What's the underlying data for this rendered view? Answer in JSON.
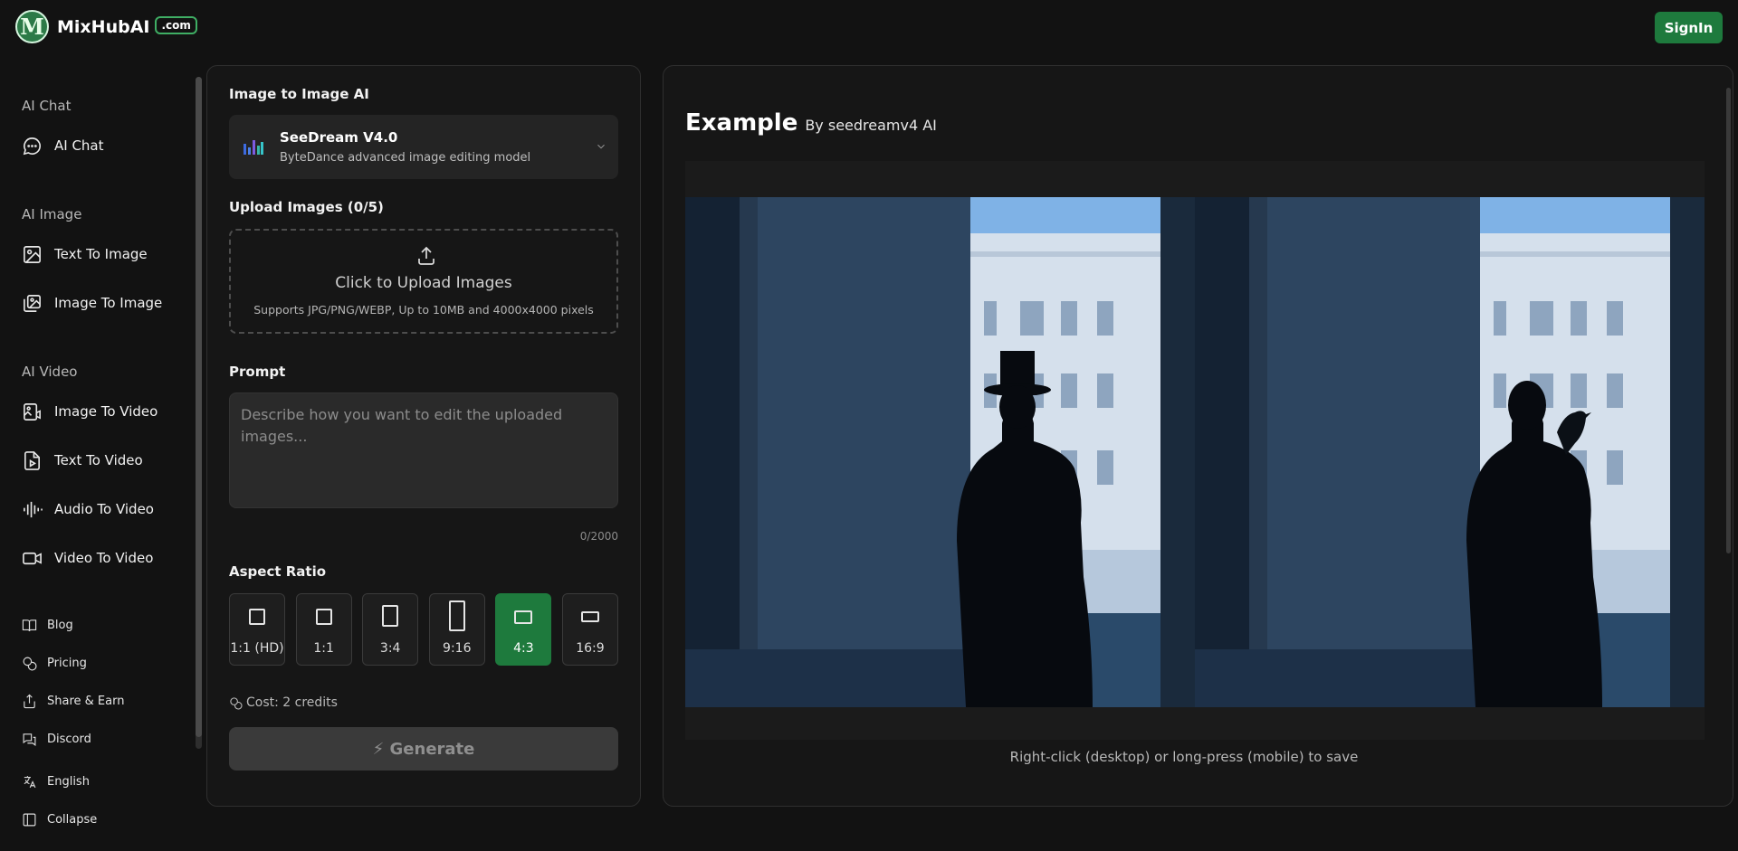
{
  "header": {
    "logo_letter": "M",
    "brand": "MixHubAI",
    "badge": ".com",
    "signin_label": "SignIn"
  },
  "sidebar": {
    "sections": [
      {
        "title": "AI Chat",
        "items": [
          {
            "label": "AI Chat",
            "icon": "chat-bubble-icon"
          }
        ]
      },
      {
        "title": "AI Image",
        "items": [
          {
            "label": "Text To Image",
            "icon": "image-icon"
          },
          {
            "label": "Image To Image",
            "icon": "images-icon"
          }
        ]
      },
      {
        "title": "AI Video",
        "items": [
          {
            "label": "Image To Video",
            "icon": "image-video-icon"
          },
          {
            "label": "Text To Video",
            "icon": "file-video-icon"
          },
          {
            "label": "Audio To Video",
            "icon": "audio-wave-icon"
          },
          {
            "label": "Video To Video",
            "icon": "video-camera-icon"
          }
        ]
      }
    ],
    "footer_items": [
      {
        "label": "Blog",
        "icon": "book-icon"
      },
      {
        "label": "Pricing",
        "icon": "coins-icon"
      },
      {
        "label": "Share & Earn",
        "icon": "share-icon"
      },
      {
        "label": "Discord",
        "icon": "discord-icon"
      },
      {
        "label": "English",
        "icon": "translate-icon"
      },
      {
        "label": "Collapse",
        "icon": "collapse-sidebar-icon"
      }
    ]
  },
  "form": {
    "title": "Image to Image AI",
    "model": {
      "name": "SeeDream V4.0",
      "description": "ByteDance advanced image editing model"
    },
    "upload": {
      "label": "Upload Images (0/5)",
      "title": "Click to Upload Images",
      "subtitle": "Supports JPG/PNG/WEBP, Up to 10MB and 4000x4000 pixels"
    },
    "prompt": {
      "label": "Prompt",
      "placeholder": "Describe how you want to edit the uploaded images...",
      "value": "",
      "counter": "0/2000"
    },
    "aspect_ratio": {
      "label": "Aspect Ratio",
      "options": [
        "1:1 (HD)",
        "1:1",
        "3:4",
        "9:16",
        "4:3",
        "16:9"
      ],
      "selected": "4:3"
    },
    "cost": "Cost: 2 credits",
    "generate_label": "⚡ Generate"
  },
  "example": {
    "title": "Example",
    "by": "By seedreamv4 AI",
    "save_hint": "Right-click (desktop) or long-press (mobile) to save"
  },
  "colors": {
    "accent": "#1e7a3d",
    "background": "#121212",
    "panel": "#161616"
  }
}
